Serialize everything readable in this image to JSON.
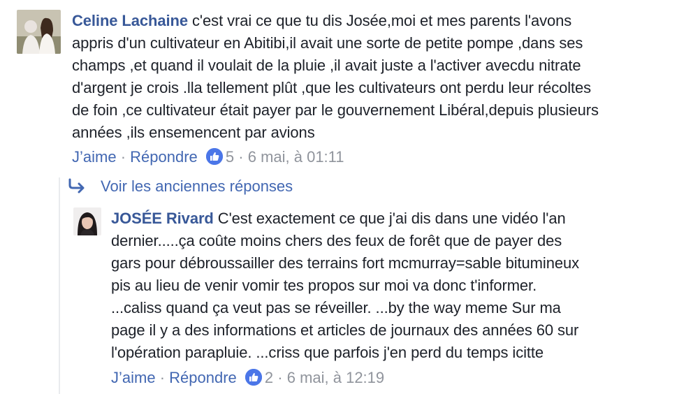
{
  "comment1": {
    "author": "Celine Lachaine",
    "lines": [
      " c'est vrai ce que tu dis Josée,moi et mes parents l'avons",
      "appris d'un cultivateur en Abitibi,il avait une sorte de petite pompe ,dans ses",
      "champs ,et quand il voulait de la pluie ,il avait juste a l'activer avecdu nitrate",
      "d'argent je crois .lla tellement plût ,que les cultivateurs ont perdu leur récoltes",
      "de foin ,ce cultivateur était payer par le gouvernement Libéral,depuis plusieurs",
      "années ,ils ensemencent par avions"
    ],
    "like_label": "J’aime",
    "dot": " · ",
    "reply_label": "Répondre",
    "reaction_count": "5",
    "timestamp": "6 mai, à 01:11"
  },
  "older_replies_label": "Voir les anciennes réponses",
  "comment2": {
    "author": "JOSÉE Rivard",
    "lines": [
      " C'est exactement ce que j'ai dis dans une vidéo l'an",
      "dernier.....ça coûte moins chers des feux de forêt que de payer des",
      "gars pour débroussailler des terrains fort mcmurray=sable bitumineux",
      "pis au lieu de venir vomir tes propos sur moi va donc t'informer.",
      "...caliss quand ça veut pas se réveiller. ...by the way meme Sur ma",
      "page il y a des informations et articles de journaux des années 60 sur",
      "l'opération parapluie. ...criss que parfois j'en perd du temps icitte"
    ],
    "like_label": "J’aime",
    "dot": " · ",
    "reply_label": "Répondre",
    "reaction_count": "2",
    "timestamp": "6 mai, à 12:19"
  },
  "colors": {
    "link_blue": "#385898",
    "action_blue": "#4267b2",
    "meta_gray": "#90949c",
    "like_badge": "#4b76e8"
  },
  "icons": {
    "reaction": "thumbs-up-icon",
    "older_replies": "reply-arrow-icon"
  }
}
